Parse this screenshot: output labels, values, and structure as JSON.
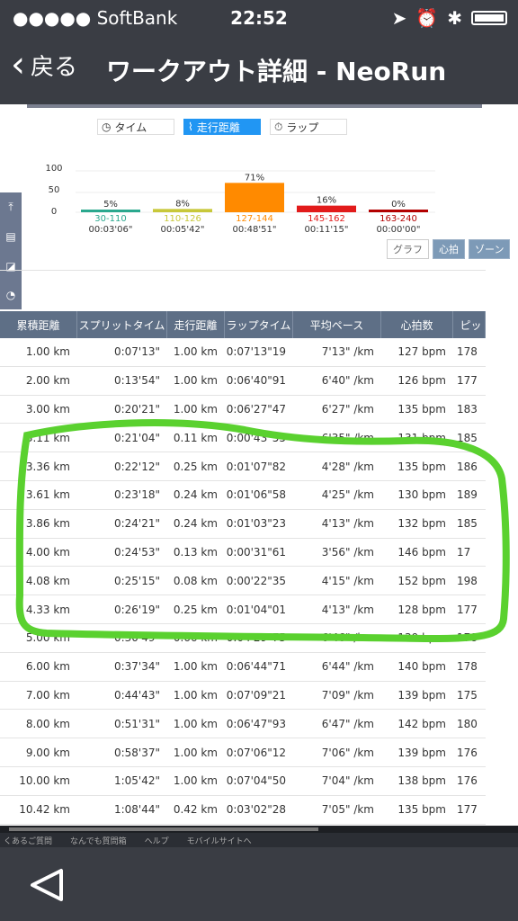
{
  "status": {
    "carrier": "●●●●● SoftBank",
    "wifi_icon": "wifi-icon",
    "time": "22:52",
    "right_icons": [
      "location-icon",
      "alarm-icon",
      "bluetooth-icon",
      "battery-icon"
    ]
  },
  "nav": {
    "back_label": "戻る",
    "title": "ワークアウト詳細 - NeoRun"
  },
  "tabs": [
    {
      "label": "タイム",
      "icon": "clock-icon"
    },
    {
      "label": "走行距離",
      "icon": "route-icon"
    },
    {
      "label": "ラップ",
      "icon": "stopwatch-icon"
    }
  ],
  "zones": {
    "y_ticks": [
      "100",
      "50",
      "0"
    ],
    "items": [
      {
        "pct": "5%",
        "range": "30-110",
        "time": "00:03'06\"",
        "color": "#2aa88e"
      },
      {
        "pct": "8%",
        "range": "110-126",
        "time": "00:05'42\"",
        "color": "#c8c83a"
      },
      {
        "pct": "71%",
        "range": "127-144",
        "time": "00:48'51\"",
        "color": "#ff8a00"
      },
      {
        "pct": "16%",
        "range": "145-162",
        "time": "00:11'15\"",
        "color": "#e21b1b"
      },
      {
        "pct": "0%",
        "range": "163-240",
        "time": "00:00'00\"",
        "color": "#b30000"
      }
    ]
  },
  "zone_buttons": [
    "グラフ",
    "心拍",
    "ゾーン"
  ],
  "table": {
    "headers": [
      "累積距離",
      "スプリットタイム",
      "走行距離",
      "ラップタイム",
      "平均ペース",
      "心拍数",
      "ピッ"
    ],
    "rows": [
      [
        "1.00 km",
        "0:07'13\"",
        "1.00 km",
        "0:07'13\"19",
        "7'13\" /km",
        "127 bpm",
        "178"
      ],
      [
        "2.00 km",
        "0:13'54\"",
        "1.00 km",
        "0:06'40\"91",
        "6'40\" /km",
        "126 bpm",
        "177"
      ],
      [
        "3.00 km",
        "0:20'21\"",
        "1.00 km",
        "0:06'27\"47",
        "6'27\" /km",
        "135 bpm",
        "183"
      ],
      [
        "3.11 km",
        "0:21'04\"",
        "0.11 km",
        "0:00'43\"55",
        "6'35\" /km",
        "131 bpm",
        "185"
      ],
      [
        "3.36 km",
        "0:22'12\"",
        "0.25 km",
        "0:01'07\"82",
        "4'28\" /km",
        "135 bpm",
        "186"
      ],
      [
        "3.61 km",
        "0:23'18\"",
        "0.24 km",
        "0:01'06\"58",
        "4'25\" /km",
        "130 bpm",
        "189"
      ],
      [
        "3.86 km",
        "0:24'21\"",
        "0.24 km",
        "0:01'03\"23",
        "4'13\" /km",
        "132 bpm",
        "185"
      ],
      [
        "4.00 km",
        "0:24'53\"",
        "0.13 km",
        "0:00'31\"61",
        "3'56\" /km",
        "146 bpm",
        "17"
      ],
      [
        "4.08 km",
        "0:25'15\"",
        "0.08 km",
        "0:00'22\"35",
        "4'15\" /km",
        "152 bpm",
        "198"
      ],
      [
        "4.33 km",
        "0:26'19\"",
        "0.25 km",
        "0:01'04\"01",
        "4'13\" /km",
        "128 bpm",
        "177"
      ],
      [
        "5.00 km",
        "0:30'49\"",
        "0.66 km",
        "0:04'29\"75",
        "6'46\" /km",
        "139 bpm",
        "178"
      ],
      [
        "6.00 km",
        "0:37'34\"",
        "1.00 km",
        "0:06'44\"71",
        "6'44\" /km",
        "140 bpm",
        "178"
      ],
      [
        "7.00 km",
        "0:44'43\"",
        "1.00 km",
        "0:07'09\"21",
        "7'09\" /km",
        "139 bpm",
        "175"
      ],
      [
        "8.00 km",
        "0:51'31\"",
        "1.00 km",
        "0:06'47\"93",
        "6'47\" /km",
        "142 bpm",
        "180"
      ],
      [
        "9.00 km",
        "0:58'37\"",
        "1.00 km",
        "0:07'06\"12",
        "7'06\" /km",
        "139 bpm",
        "176"
      ],
      [
        "10.00 km",
        "1:05'42\"",
        "1.00 km",
        "0:07'04\"50",
        "7'04\" /km",
        "138 bpm",
        "176"
      ],
      [
        "10.42 km",
        "1:08'44\"",
        "0.42 km",
        "0:03'02\"28",
        "7'05\" /km",
        "135 bpm",
        "177"
      ]
    ]
  },
  "footer_links": [
    "くあるご質問",
    "なんでも質問箱",
    "ヘルプ",
    "モバイルサイトへ"
  ],
  "colors": {
    "accent": "#2196f3",
    "header": "#5e6f86",
    "highlight": "#5ad12f"
  }
}
